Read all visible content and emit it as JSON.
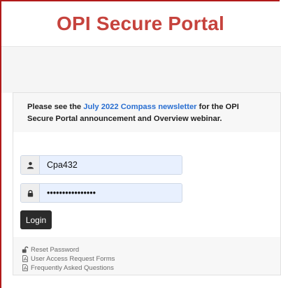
{
  "header": {
    "title": "OPI Secure Portal"
  },
  "notice": {
    "prefix": "Please see the ",
    "link_text": "July 2022 Compass newsletter",
    "suffix": " for the OPI Secure Portal announcement and Overview webinar."
  },
  "form": {
    "username_value": "Cpa432",
    "password_value": "••••••••••••••••",
    "login_label": "Login"
  },
  "links": [
    {
      "label": "Reset Password",
      "icon": "unlock-icon"
    },
    {
      "label": "User Access Request Forms",
      "icon": "pdf-file-icon"
    },
    {
      "label": "Frequently Asked Questions",
      "icon": "pdf-file-icon"
    }
  ],
  "colors": {
    "title": "#c6433d",
    "link": "#2a6fd1",
    "button": "#2b2b2b",
    "frame": "#b11a1a"
  }
}
